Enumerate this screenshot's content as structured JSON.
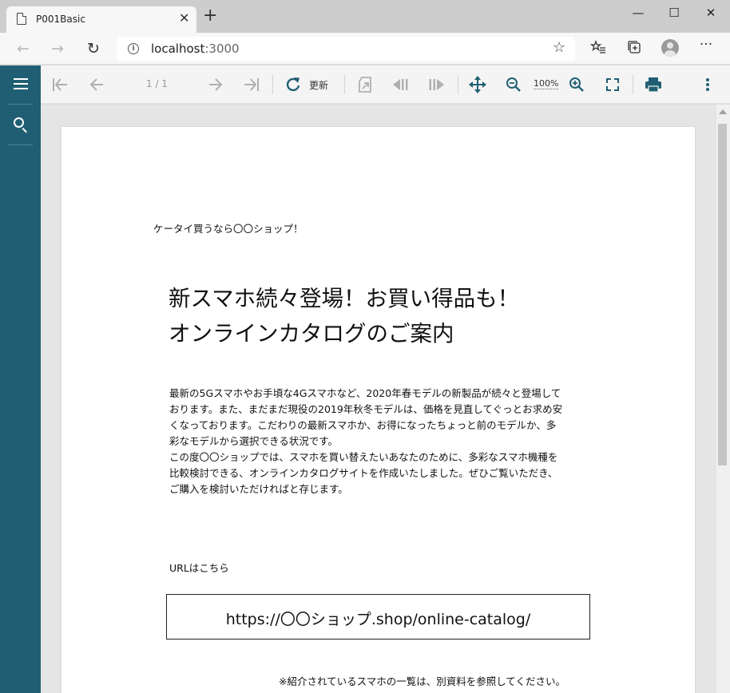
{
  "browser": {
    "tab_title": "P001Basic",
    "tab_close": "✕",
    "new_tab": "+",
    "window_controls": {
      "minimize": "—",
      "maximize": "☐",
      "close": "✕"
    },
    "nav": {
      "back": "←",
      "forward": "→",
      "reload": "↻"
    },
    "url_host": "localhost",
    "url_port": ":3000",
    "icons": [
      "page-icon",
      "info-icon",
      "star-icon",
      "favorites-icon",
      "collections-icon",
      "profile-avatar",
      "more-icon"
    ]
  },
  "viewer": {
    "page_indicator": "1 / 1",
    "refresh_label": "更新",
    "zoom_label": "100%",
    "accent_color": "#205f73"
  },
  "document": {
    "tagline": "ケータイ買うなら〇〇ショップ！",
    "headline_lines": [
      "新スマホ続々登場！お買い得品も！",
      "オンラインカタログのご案内"
    ],
    "body_lines": [
      "最新の5Gスマホやお手頃な4Gスマホなど、2020年春モデルの新製品が続々と登場して",
      "おります。また、まだまだ現役の2019年秋冬モデルは、価格を見直してぐっとお求め安",
      "くなっております。こだわりの最新スマホか、お得になったちょっと前のモデルか、多",
      "彩なモデルから選択できる状況です。",
      "この度〇〇ショップでは、スマホを買い替えたいあなたのために、多彩なスマホ機種を",
      "比較検討できる、オンラインカタログサイトを作成いたしました。ぜひご覧いただき、",
      "ご購入を検討いただければと存じます。"
    ],
    "url_label": "URLはこちら",
    "catalog_url": "https://〇〇ショップ.shop/online-catalog/",
    "footnote": "※紹介されているスマホの一覧は、別資料を参照してください。"
  }
}
